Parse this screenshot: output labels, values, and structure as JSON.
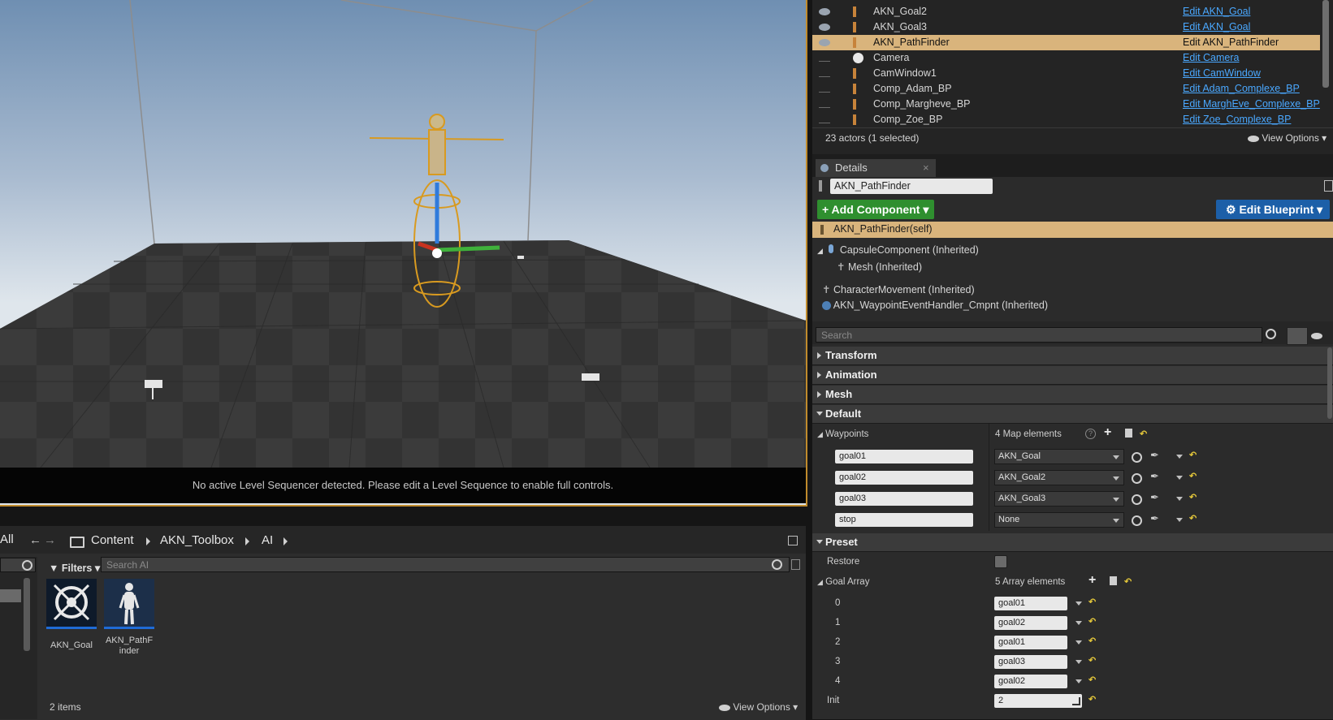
{
  "viewport": {
    "sequencer_message": "No active Level Sequencer detected. Please edit a Level Sequence to enable full controls."
  },
  "outliner": {
    "rows": [
      {
        "name": "AKN_Goal2",
        "link": "Edit AKN_Goal",
        "visible": true,
        "selected": false
      },
      {
        "name": "AKN_Goal3",
        "link": "Edit AKN_Goal",
        "visible": true,
        "selected": false
      },
      {
        "name": "AKN_PathFinder",
        "link": "Edit AKN_PathFinder",
        "visible": true,
        "selected": true
      },
      {
        "name": "Camera",
        "link": "Edit Camera",
        "visible": false,
        "selected": false
      },
      {
        "name": "CamWindow1",
        "link": "Edit CamWindow",
        "visible": false,
        "selected": false
      },
      {
        "name": "Comp_Adam_BP",
        "link": "Edit Adam_Complexe_BP",
        "visible": false,
        "selected": false
      },
      {
        "name": "Comp_Margheve_BP",
        "link": "Edit MarghEve_Complexe_BP",
        "visible": false,
        "selected": false
      },
      {
        "name": "Comp_Zoe_BP",
        "link": "Edit Zoe_Complexe_BP",
        "visible": false,
        "selected": false
      }
    ],
    "status": "23 actors (1 selected)",
    "view_options": "View Options"
  },
  "details": {
    "tab_title": "Details",
    "actor_name": "AKN_PathFinder",
    "add_component": "+ Add Component",
    "edit_blueprint": "Edit Blueprint",
    "self_component": "AKN_PathFinder(self)",
    "components": [
      "CapsuleComponent (Inherited)",
      "Mesh (Inherited)",
      "CharacterMovement (Inherited)",
      "AKN_WaypointEventHandler_Cmpnt (Inherited)"
    ],
    "search_placeholder": "Search",
    "categories": [
      "Transform",
      "Animation",
      "Mesh",
      "Default"
    ],
    "waypoints": {
      "label": "Waypoints",
      "count": "4 Map elements",
      "entries": [
        {
          "key": "goal01",
          "value": "AKN_Goal"
        },
        {
          "key": "goal02",
          "value": "AKN_Goal2"
        },
        {
          "key": "goal03",
          "value": "AKN_Goal3"
        },
        {
          "key": "stop",
          "value": "None"
        }
      ]
    },
    "preset": {
      "label": "Preset",
      "restore_label": "Restore",
      "goal_array_label": "Goal Array",
      "goal_array_count": "5 Array elements",
      "goal_array": [
        {
          "index": "0",
          "value": "goal01"
        },
        {
          "index": "1",
          "value": "goal02"
        },
        {
          "index": "2",
          "value": "goal01"
        },
        {
          "index": "3",
          "value": "goal03"
        },
        {
          "index": "4",
          "value": "goal02"
        }
      ],
      "init_label": "Init",
      "init_value": "2"
    }
  },
  "content_browser": {
    "all_label": "All",
    "breadcrumb": [
      "Content",
      "AKN_Toolbox",
      "AI"
    ],
    "filters_label": "Filters",
    "search_placeholder": "Search AI",
    "assets": [
      {
        "name": "AKN_Goal",
        "icon": "target-icon"
      },
      {
        "name": "AKN_PathF\ninder",
        "icon": "mannequin-icon"
      }
    ],
    "item_count": "2 items",
    "view_options": "View Options"
  }
}
